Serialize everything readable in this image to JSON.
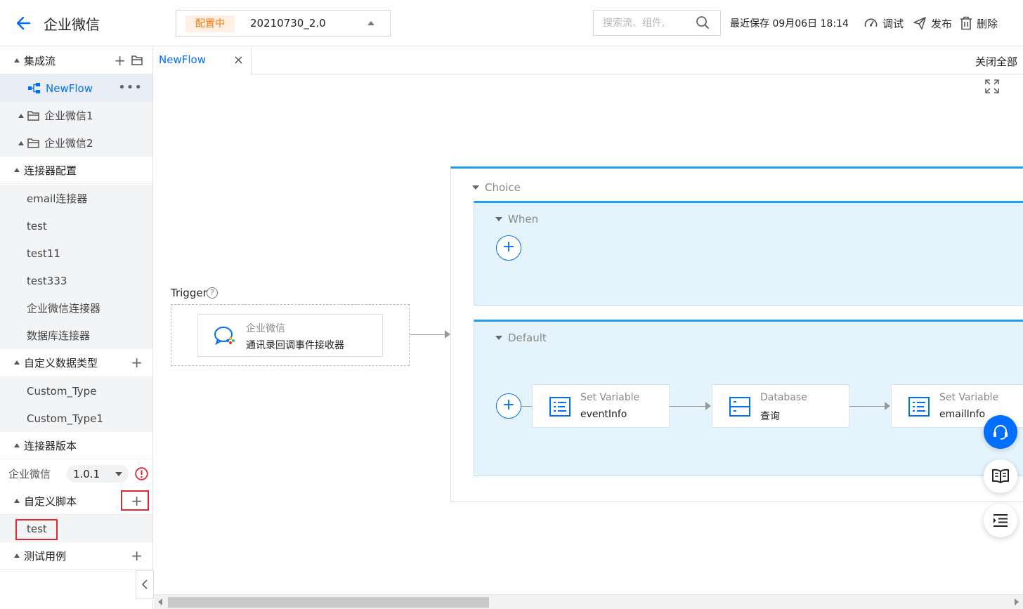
{
  "header": {
    "title": "企业微信",
    "status_badge": "配置中",
    "version": "20210730_2.0",
    "search_placeholder": "搜索流、组件,",
    "last_saved": "最近保存 09月06日 18:14",
    "actions": {
      "debug": "调试",
      "publish": "发布",
      "delete": "删除"
    }
  },
  "sidebar": {
    "flows_section": "集成流",
    "flows": [
      {
        "label": "NewFlow",
        "active": true
      },
      {
        "label": "企业微信1"
      },
      {
        "label": "企业微信2"
      }
    ],
    "connector_config_section": "连接器配置",
    "connectors": [
      "email连接器",
      "test",
      "test11",
      "test333",
      "企业微信连接器",
      "数据库连接器"
    ],
    "datatype_section": "自定义数据类型",
    "datatypes": [
      "Custom_Type",
      "Custom_Type1"
    ],
    "version_section": "连接器版本",
    "version_row": {
      "name": "企业微信",
      "value": "1.0.1"
    },
    "script_section": "自定义脚本",
    "scripts": [
      "test"
    ],
    "testcase_section": "测试用例"
  },
  "tabs": {
    "items": [
      {
        "label": "NewFlow"
      }
    ],
    "close_all": "关闭全部"
  },
  "canvas": {
    "trigger_label": "Trigger",
    "trigger_node": {
      "category": "企业微信",
      "name": "通讯录回调事件接收器"
    },
    "choice_label": "Choice",
    "when_label": "When",
    "default_label": "Default",
    "default_nodes": [
      {
        "type": "Set Variable",
        "name": "eventInfo"
      },
      {
        "type": "Database",
        "name": "查询"
      },
      {
        "type": "Set Variable",
        "name": "emailInfo"
      }
    ]
  },
  "colors": {
    "accent": "#006eff",
    "branch_bg": "#e5f4fc",
    "branch_border": "#1e9eef",
    "highlight": "#e0282e",
    "badge": "#ff7800"
  }
}
